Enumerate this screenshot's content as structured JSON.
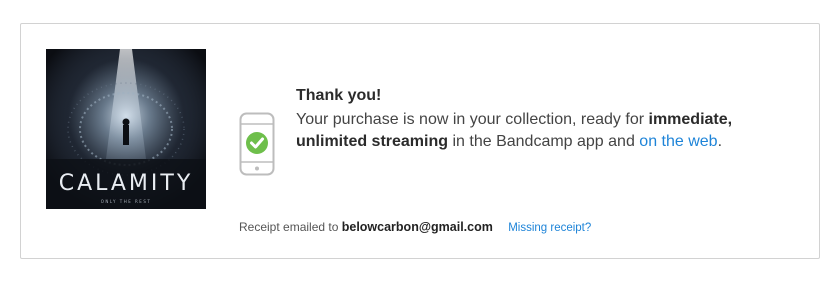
{
  "album": {
    "title": "CALAMITY",
    "subtitle": "ONLY THE REST"
  },
  "confirmation": {
    "heading": "Thank you!",
    "line_prefix": "Your purchase is now in your collection, ready for",
    "emphasis": "immediate, unlimited streaming",
    "line_middle": "in the Bandcamp app and",
    "web_link": "on the web",
    "line_suffix": "."
  },
  "receipt": {
    "label": "Receipt emailed to",
    "email": "belowcarbon@gmail.com",
    "missing_link": "Missing receipt?"
  },
  "icons": {
    "phone": "phone-check-icon"
  },
  "colors": {
    "link": "#1e84d8",
    "check": "#6ebf4b",
    "border": "#d2d2d2"
  }
}
